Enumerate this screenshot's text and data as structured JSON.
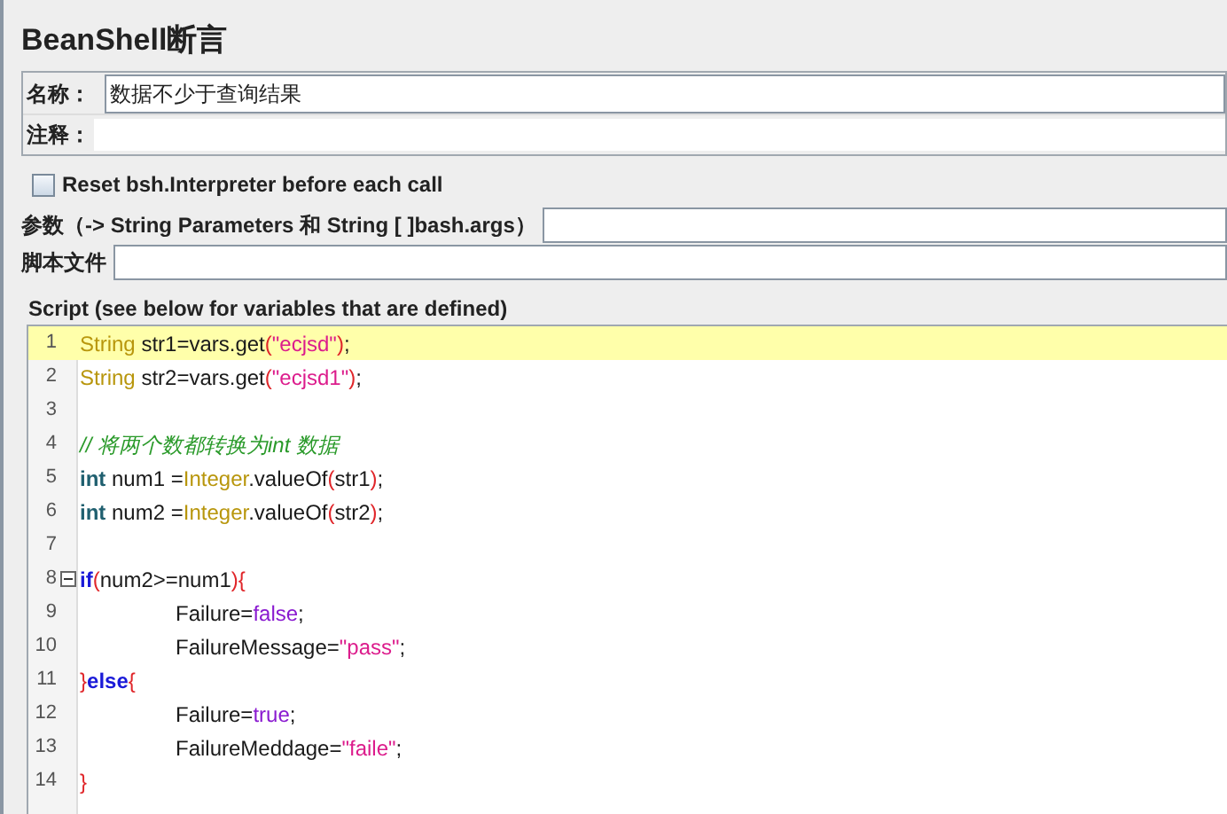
{
  "title": "BeanShell断言",
  "name_field": {
    "label": "名称：",
    "value": "数据不少于查询结果"
  },
  "comment_field": {
    "label": "注释："
  },
  "reset_option": {
    "label": "Reset bsh.Interpreter before each call",
    "checked": false
  },
  "parameters_field": {
    "label": "参数（-> String Parameters 和 String [ ]bash.args）"
  },
  "script_file_field": {
    "label": "脚本文件"
  },
  "script_label": "Script (see below for variables that are defined)",
  "code_lines": [
    {
      "number": "1",
      "highlighted": true,
      "indented": false,
      "fold": false,
      "tokens": [
        {
          "text": "String",
          "kind": "type"
        },
        {
          "text": " str1=vars.get",
          "kind": "plain"
        },
        {
          "text": "(",
          "kind": "paren"
        },
        {
          "text": "\"ecjsd\"",
          "kind": "string"
        },
        {
          "text": ")",
          "kind": "paren"
        },
        {
          "text": ";",
          "kind": "plain"
        }
      ]
    },
    {
      "number": "2",
      "highlighted": false,
      "indented": false,
      "fold": false,
      "tokens": [
        {
          "text": "String",
          "kind": "type"
        },
        {
          "text": " str2=vars.get",
          "kind": "plain"
        },
        {
          "text": "(",
          "kind": "paren"
        },
        {
          "text": "\"ecjsd1\"",
          "kind": "string"
        },
        {
          "text": ")",
          "kind": "paren"
        },
        {
          "text": ";",
          "kind": "plain"
        }
      ]
    },
    {
      "number": "3",
      "highlighted": false,
      "fold": false
    },
    {
      "number": "4",
      "highlighted": false,
      "indented": false,
      "fold": false,
      "tokens": [
        {
          "text": "// 将两个数都转换为int 数据",
          "kind": "comment"
        }
      ]
    },
    {
      "number": "5",
      "highlighted": false,
      "indented": false,
      "fold": false,
      "tokens": [
        {
          "text": "int",
          "kind": "primitive"
        },
        {
          "text": " num1 =",
          "kind": "plain"
        },
        {
          "text": "Integer",
          "kind": "type"
        },
        {
          "text": ".valueOf",
          "kind": "plain"
        },
        {
          "text": "(",
          "kind": "paren"
        },
        {
          "text": "str1",
          "kind": "plain"
        },
        {
          "text": ")",
          "kind": "paren"
        },
        {
          "text": ";",
          "kind": "plain"
        }
      ]
    },
    {
      "number": "6",
      "highlighted": false,
      "indented": false,
      "fold": false,
      "tokens": [
        {
          "text": "int",
          "kind": "primitive"
        },
        {
          "text": " num2 =",
          "kind": "plain"
        },
        {
          "text": "Integer",
          "kind": "type"
        },
        {
          "text": ".valueOf",
          "kind": "plain"
        },
        {
          "text": "(",
          "kind": "paren"
        },
        {
          "text": "str2",
          "kind": "plain"
        },
        {
          "text": ")",
          "kind": "paren"
        },
        {
          "text": ";",
          "kind": "plain"
        }
      ]
    },
    {
      "number": "7",
      "highlighted": false,
      "fold": false
    },
    {
      "number": "8",
      "highlighted": false,
      "indented": false,
      "fold": true,
      "tokens": [
        {
          "text": "if",
          "kind": "keyword"
        },
        {
          "text": "(",
          "kind": "paren"
        },
        {
          "text": "num2>=num1",
          "kind": "plain"
        },
        {
          "text": "){",
          "kind": "paren"
        }
      ]
    },
    {
      "number": "9",
      "highlighted": false,
      "indented": true,
      "fold": false,
      "tokens": [
        {
          "text": "Failure=",
          "kind": "plain"
        },
        {
          "text": "false",
          "kind": "literal"
        },
        {
          "text": ";",
          "kind": "plain"
        }
      ]
    },
    {
      "number": "10",
      "highlighted": false,
      "indented": true,
      "fold": false,
      "tokens": [
        {
          "text": "FailureMessage=",
          "kind": "plain"
        },
        {
          "text": "\"pass\"",
          "kind": "string"
        },
        {
          "text": ";",
          "kind": "plain"
        }
      ]
    },
    {
      "number": "11",
      "highlighted": false,
      "indented": false,
      "fold": false,
      "tokens": [
        {
          "text": "}",
          "kind": "paren"
        },
        {
          "text": "else",
          "kind": "keyword"
        },
        {
          "text": "{",
          "kind": "paren"
        }
      ]
    },
    {
      "number": "12",
      "highlighted": false,
      "indented": true,
      "fold": false,
      "tokens": [
        {
          "text": "Failure=",
          "kind": "plain"
        },
        {
          "text": "true",
          "kind": "literal"
        },
        {
          "text": ";",
          "kind": "plain"
        }
      ]
    },
    {
      "number": "13",
      "highlighted": false,
      "indented": true,
      "fold": false,
      "tokens": [
        {
          "text": "FailureMeddage=",
          "kind": "plain"
        },
        {
          "text": "\"faile\"",
          "kind": "string"
        },
        {
          "text": ";",
          "kind": "plain"
        }
      ]
    },
    {
      "number": "14",
      "highlighted": false,
      "indented": false,
      "fold": false,
      "tokens": [
        {
          "text": "}",
          "kind": "paren"
        }
      ]
    }
  ]
}
